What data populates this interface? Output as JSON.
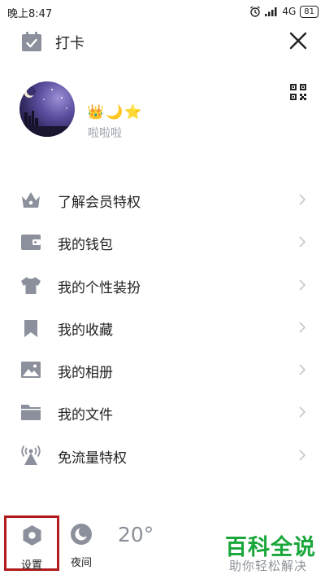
{
  "status_bar": {
    "time": "晚上8:47",
    "network": "4G",
    "battery": "81"
  },
  "header": {
    "checkin_label": "打卡"
  },
  "profile": {
    "badges": [
      "👑",
      "🌙",
      "⭐"
    ],
    "nickname": "啦啦啦"
  },
  "menu": {
    "items": [
      {
        "label": "了解会员特权",
        "icon": "crown-icon"
      },
      {
        "label": "我的钱包",
        "icon": "wallet-icon"
      },
      {
        "label": "我的个性装扮",
        "icon": "shirt-icon"
      },
      {
        "label": "我的收藏",
        "icon": "bookmark-icon"
      },
      {
        "label": "我的相册",
        "icon": "image-icon"
      },
      {
        "label": "我的文件",
        "icon": "folder-icon"
      },
      {
        "label": "免流量特权",
        "icon": "signal-tower-icon"
      }
    ]
  },
  "bottom": {
    "settings_label": "设置",
    "night_label": "夜间",
    "temperature": "20°"
  },
  "watermark": {
    "title": "百科全说",
    "subtitle": "助你轻松解决"
  },
  "colors": {
    "icon_gray": "#8c909c",
    "highlight_border": "#b01c1c",
    "watermark_green": "#19a63a"
  }
}
